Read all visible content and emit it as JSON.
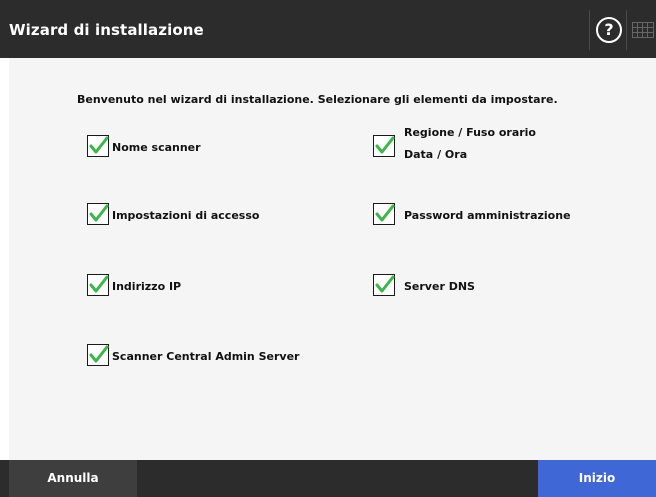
{
  "header": {
    "title": "Wizard di installazione",
    "help_symbol": "?",
    "help_icon": "help-icon",
    "keyboard_icon": "keyboard-icon"
  },
  "intro_text": "Benvenuto nel wizard di installazione. Selezionare gli elementi da impostare.",
  "options": {
    "scanner_name": {
      "label": "Nome scanner",
      "checked": true
    },
    "region_timezone": {
      "label_line1": "Regione / Fuso orario",
      "label_line2": "Data / Ora",
      "checked": true
    },
    "login_settings": {
      "label": "Impostazioni di accesso",
      "checked": true
    },
    "admin_password": {
      "label": "Password amministrazione",
      "checked": true
    },
    "ip_address": {
      "label": "Indirizzo IP",
      "checked": true
    },
    "dns_server": {
      "label": "Server DNS",
      "checked": true
    },
    "central_admin": {
      "label": "Scanner Central Admin Server",
      "checked": true
    }
  },
  "footer": {
    "cancel_label": "Annulla",
    "start_label": "Inizio"
  },
  "colors": {
    "titlebar": "#2c2c2c",
    "content_bg": "#f5f5f5",
    "check_green": "#3cb54a",
    "start_button": "#3f68d6"
  }
}
